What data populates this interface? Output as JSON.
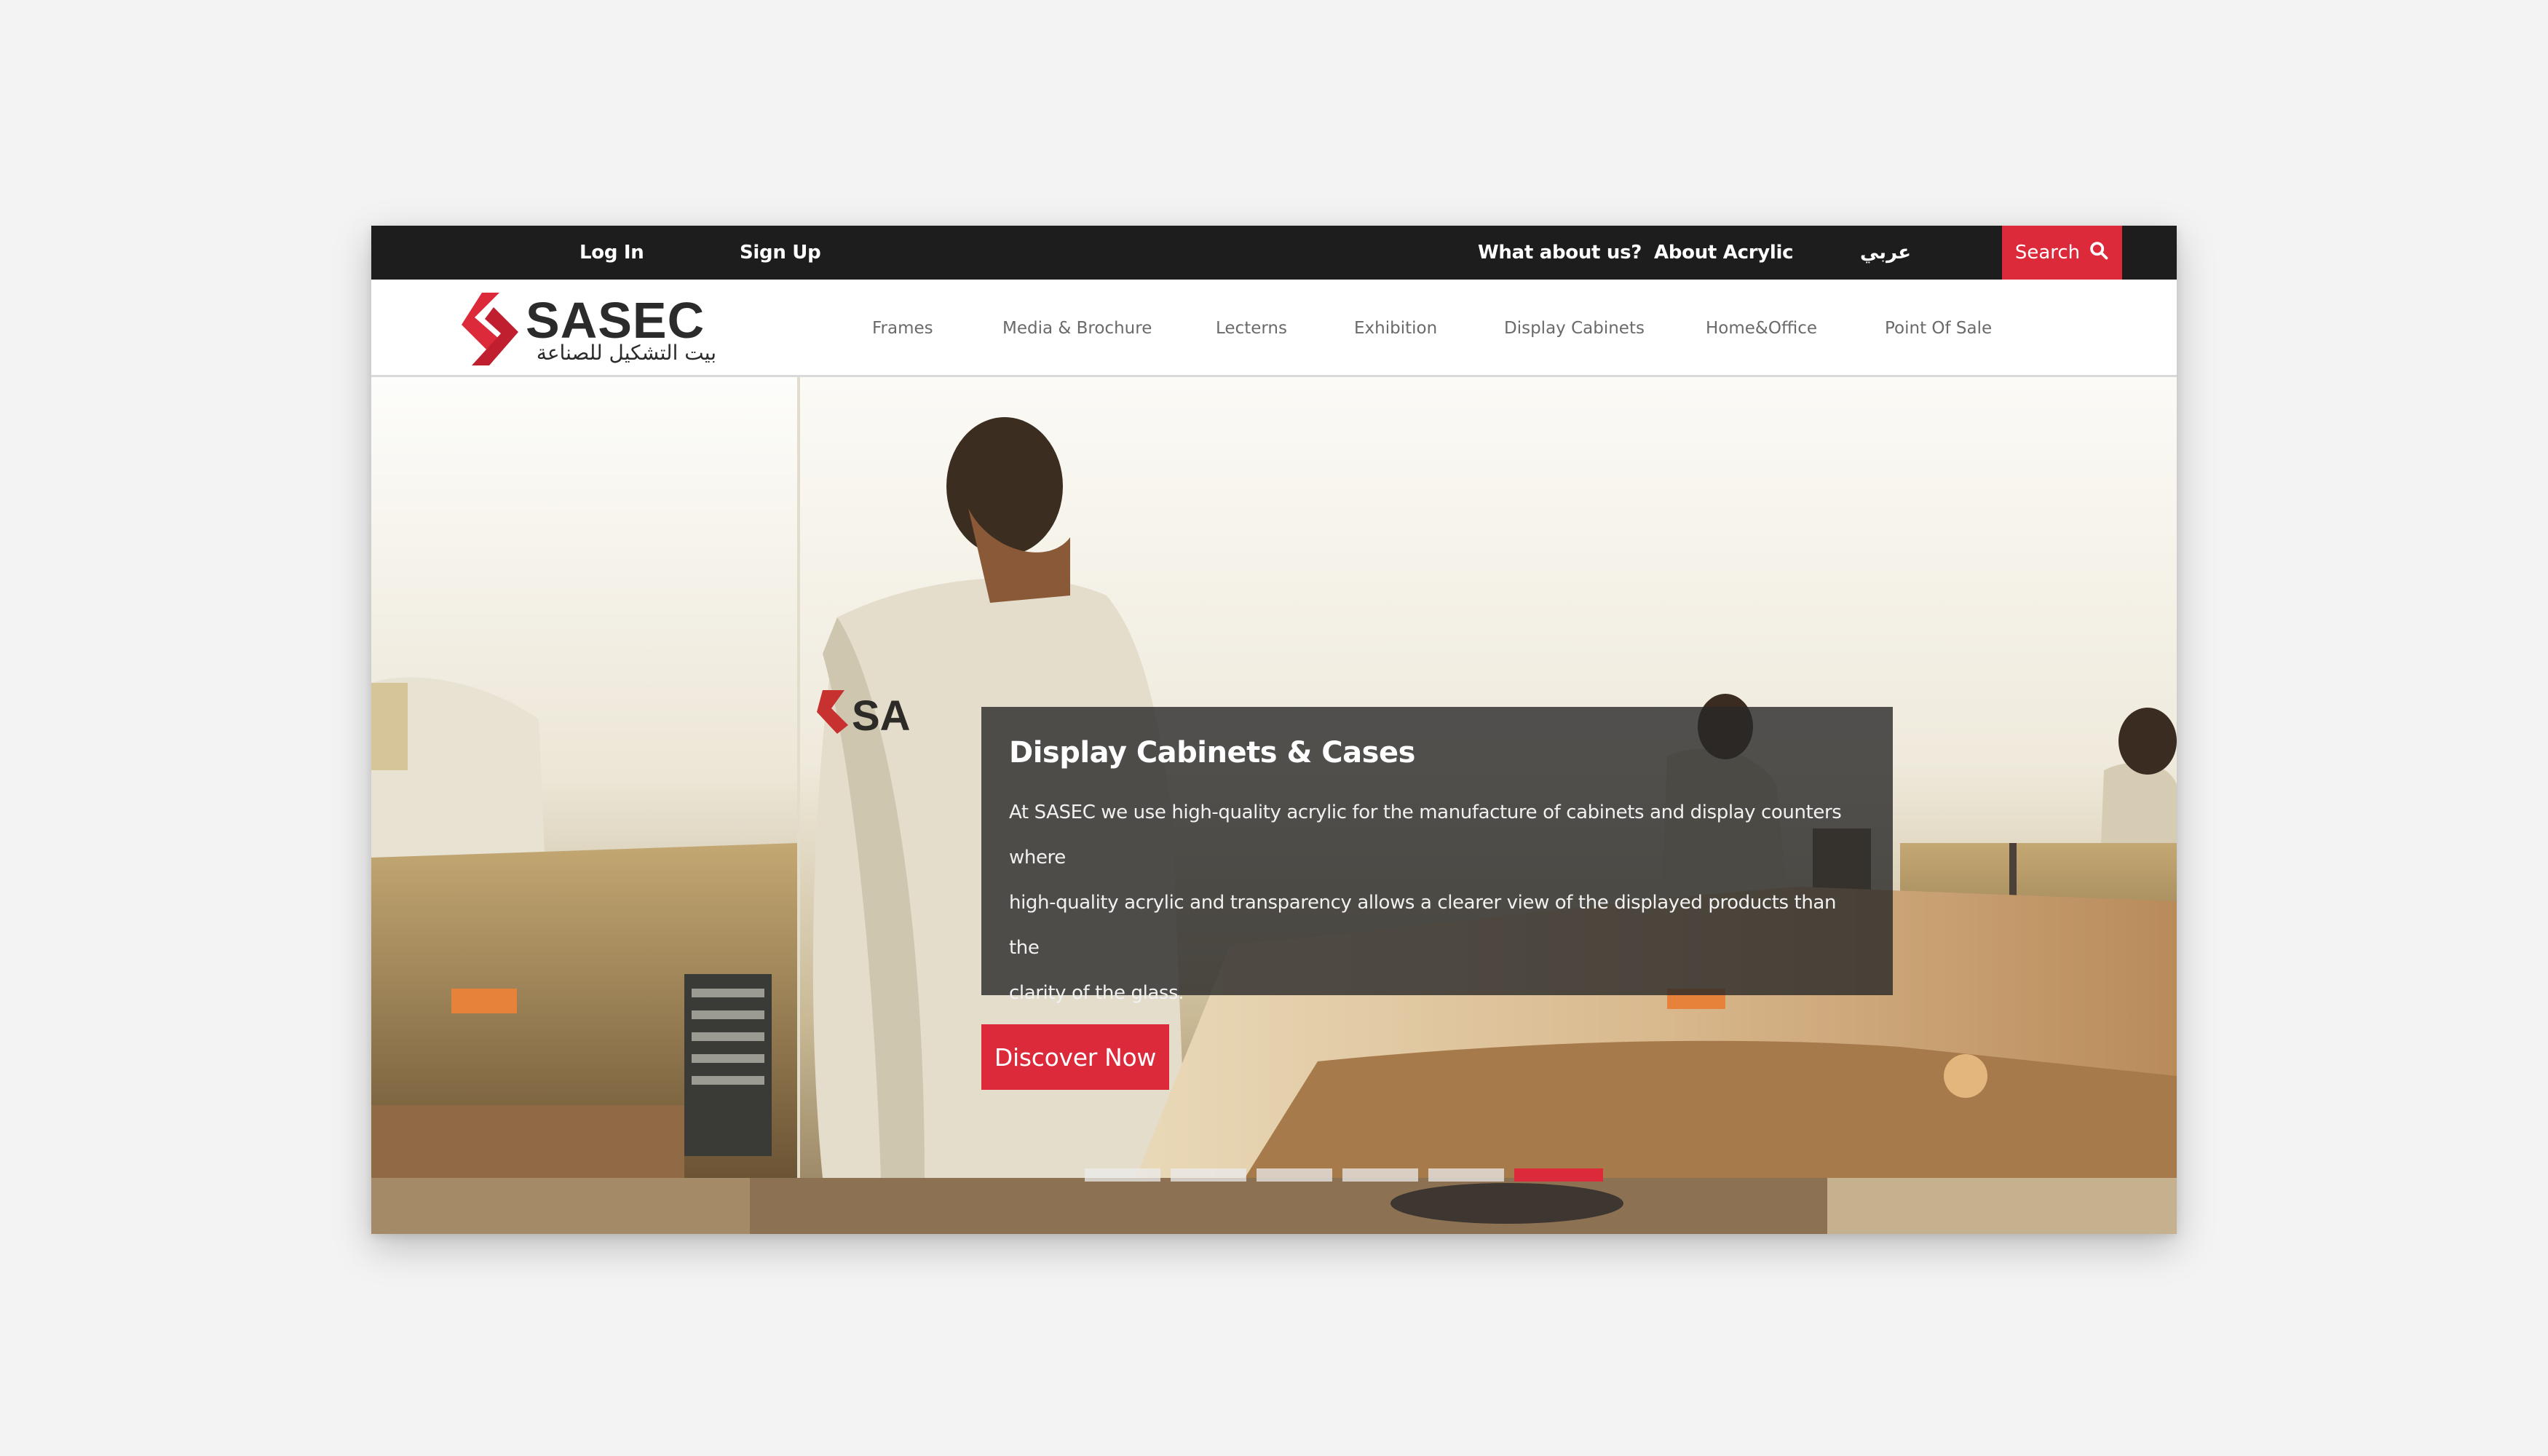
{
  "topbar": {
    "login": "Log In",
    "signup": "Sign Up",
    "about_us": "What about us?",
    "about_acrylic": "About Acrylic",
    "arabic": "عربي",
    "search_label": "Search"
  },
  "brand": {
    "name": "SASEC",
    "arabic_tagline": "بيت التشكيل للصناعة"
  },
  "nav": {
    "items": [
      {
        "label": "Frames"
      },
      {
        "label": "Media & Brochure"
      },
      {
        "label": "Lecterns"
      },
      {
        "label": "Exhibition"
      },
      {
        "label": "Display Cabinets"
      },
      {
        "label": "Home&Office"
      },
      {
        "label": "Point Of Sale"
      }
    ]
  },
  "hero": {
    "title": "Display Cabinets & Cases",
    "line1": "At SASEC we use high-quality acrylic for the manufacture of cabinets and display counters where",
    "line2": "high-quality acrylic and transparency allows a clearer view of the displayed products than the",
    "line3": "clarity of the glass.",
    "cta": "Discover Now",
    "active_slide": 6,
    "slide_count": 6
  },
  "colors": {
    "accent": "#dc2a3b",
    "topbar_bg": "#1d1d1d",
    "nav_text": "#6a6a6a"
  }
}
